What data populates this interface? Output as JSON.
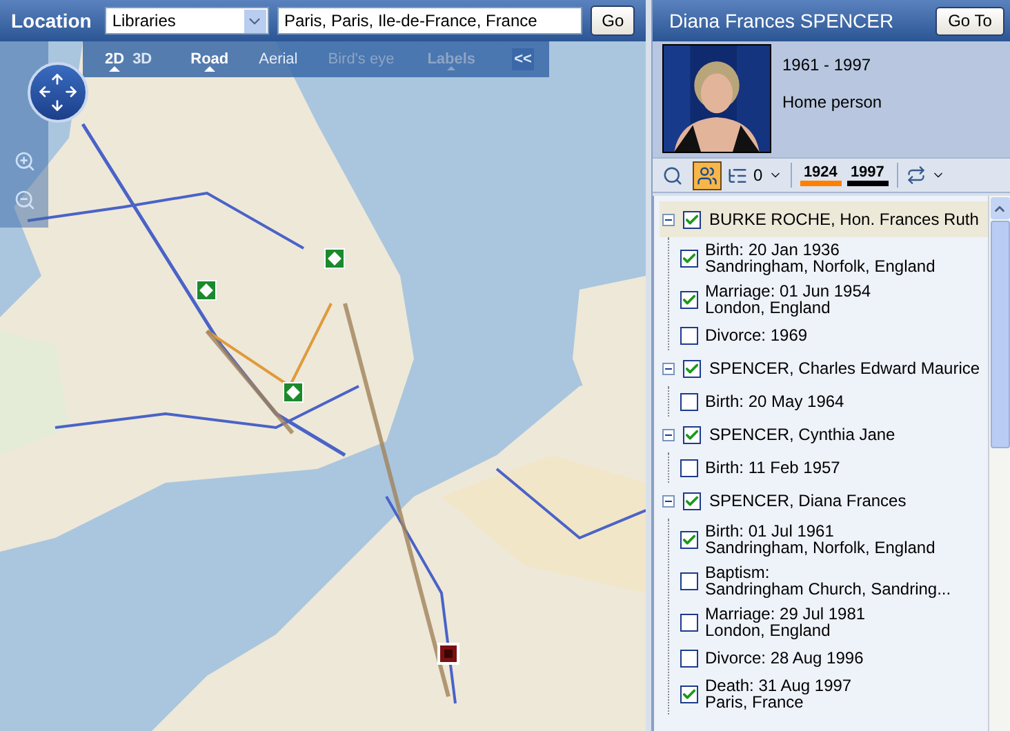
{
  "location_bar": {
    "label": "Location",
    "category": {
      "value": "Libraries"
    },
    "place": {
      "value": "Paris, Paris, Ile-de-France, France"
    },
    "go_button": "Go"
  },
  "map_toolbar": {
    "view_modes": [
      {
        "label": "2D",
        "selected": true
      },
      {
        "label": "3D",
        "selected": false
      }
    ],
    "map_styles": [
      {
        "label": "Road",
        "selected": true,
        "disabled": false
      },
      {
        "label": "Aerial",
        "selected": false,
        "disabled": false
      },
      {
        "label": "Bird's eye",
        "selected": false,
        "disabled": true
      }
    ],
    "labels_button": {
      "label": "Labels",
      "disabled": true
    },
    "collapse_button": "<<"
  },
  "person": {
    "name": "Diana Frances SPENCER",
    "goto_button": "Go To",
    "lifespan": "1961 - 1997",
    "role": "Home person"
  },
  "toolbar": {
    "tools": [
      {
        "kind": "zoom",
        "selected": false
      },
      {
        "kind": "family",
        "selected": true
      }
    ],
    "generations": "0",
    "years": [
      {
        "label": "1924",
        "color": "#ff7f00"
      },
      {
        "label": "1997",
        "color": "#000000"
      }
    ]
  },
  "tree": [
    {
      "name": "BURKE ROCHE, Hon. Frances Ruth",
      "checked": true,
      "expanded": true,
      "selected": true,
      "children": [
        {
          "event": "Birth: 20 Jan 1936",
          "place": "Sandringham, Norfolk, England",
          "checked": true
        },
        {
          "event": "Marriage: 01 Jun 1954",
          "place": "London, England",
          "checked": true
        },
        {
          "event": "Divorce: 1969",
          "checked": false
        }
      ]
    },
    {
      "name": "SPENCER, Charles Edward Maurice",
      "checked": true,
      "expanded": true,
      "selected": false,
      "children": [
        {
          "event": "Birth: 20 May 1964",
          "checked": false
        }
      ]
    },
    {
      "name": "SPENCER, Cynthia Jane",
      "checked": true,
      "expanded": true,
      "selected": false,
      "children": [
        {
          "event": "Birth: 11 Feb 1957",
          "checked": false
        }
      ]
    },
    {
      "name": "SPENCER, Diana Frances",
      "checked": true,
      "expanded": true,
      "selected": false,
      "children": [
        {
          "event": "Birth: 01 Jul 1961",
          "place": "Sandringham, Norfolk, England",
          "checked": true
        },
        {
          "event": "Baptism:",
          "place": "Sandringham Church, Sandring...",
          "checked": false
        },
        {
          "event": "Marriage: 29 Jul 1981",
          "place": "London, England",
          "checked": false
        },
        {
          "event": "Divorce: 28 Aug 1996",
          "checked": false
        },
        {
          "event": "Death: 31 Aug 1997",
          "place": "Paris, France",
          "checked": true
        }
      ]
    }
  ]
}
